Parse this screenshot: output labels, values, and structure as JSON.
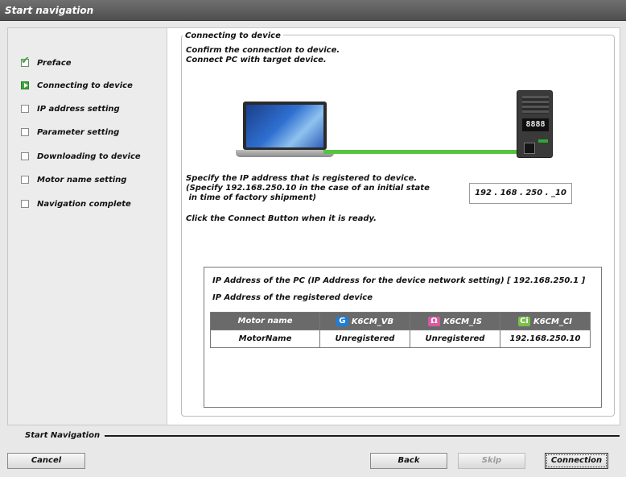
{
  "window": {
    "title": "Start navigation"
  },
  "steps": [
    {
      "label": "Preface",
      "state": "done"
    },
    {
      "label": "Connecting to device",
      "state": "active"
    },
    {
      "label": "IP address setting",
      "state": "pending"
    },
    {
      "label": "Parameter setting",
      "state": "pending"
    },
    {
      "label": "Downloading to device",
      "state": "pending"
    },
    {
      "label": "Motor name setting",
      "state": "pending"
    },
    {
      "label": "Navigation complete",
      "state": "pending"
    }
  ],
  "panel": {
    "group_title": "Connecting to device",
    "intro_line1": "Confirm the connection to device.",
    "intro_line2": "Connect PC with target device.",
    "ip_note_line1": "Specify the IP address that is registered to device.",
    "ip_note_line2": "(Specify 192.168.250.10 in the case of an initial state",
    "ip_note_line3": " in time of factory shipment)",
    "ip_value": "192 . 168 . 250 . _10",
    "connect_hint": "Click the Connect Button when it is ready.",
    "device_display": "8888",
    "pc_ip_text": "IP Address of the PC (IP Address for the device network setting)  [ 192.168.250.1 ]",
    "registered_title": "IP Address of the registered device",
    "table": {
      "headers": [
        "Motor name",
        "K6CM_VB",
        "K6CM_IS",
        "K6CM_CI"
      ],
      "header_icons": [
        "",
        "G",
        "Ω",
        "Ci"
      ],
      "row": [
        "MotorName",
        "Unregistered",
        "Unregistered",
        "192.168.250.10"
      ]
    }
  },
  "footer": {
    "label": "Start Navigation",
    "cancel": "Cancel",
    "back": "Back",
    "skip": "Skip",
    "connection": "Connection"
  },
  "colors": {
    "titlebar": "#5a5a5a",
    "cable": "#55c53f",
    "active_step": "#3aa83a"
  }
}
